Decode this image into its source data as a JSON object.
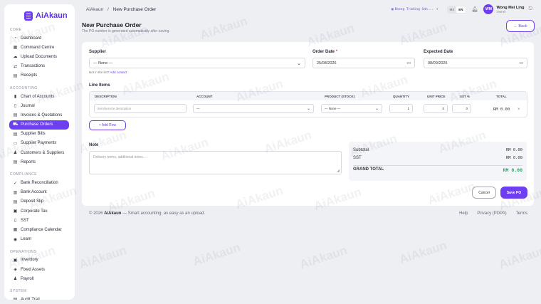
{
  "brand": {
    "name": "AiAkaun"
  },
  "sidebar": {
    "sections": [
      {
        "label": "CORE",
        "items": [
          {
            "label": "Dashboard",
            "icon": "gauge-icon"
          },
          {
            "label": "Command Centre",
            "icon": "grid-icon"
          },
          {
            "label": "Upload Documents",
            "icon": "cloud-upload-icon"
          },
          {
            "label": "Transactions",
            "icon": "transfer-icon"
          },
          {
            "label": "Receipts",
            "icon": "receipt-icon"
          }
        ]
      },
      {
        "label": "ACCOUNTING",
        "items": [
          {
            "label": "Chart of Accounts",
            "icon": "bar-chart-icon"
          },
          {
            "label": "Journal",
            "icon": "book-icon"
          },
          {
            "label": "Invoices & Quotations",
            "icon": "invoice-icon"
          },
          {
            "label": "Purchase Orders",
            "icon": "cart-icon"
          },
          {
            "label": "Supplier Bills",
            "icon": "bill-icon"
          },
          {
            "label": "Supplier Payments",
            "icon": "card-icon"
          },
          {
            "label": "Customers & Suppliers",
            "icon": "users-icon"
          },
          {
            "label": "Reports",
            "icon": "report-icon"
          }
        ]
      },
      {
        "label": "COMPLIANCE",
        "items": [
          {
            "label": "Bank Reconciliation",
            "icon": "check-icon"
          },
          {
            "label": "Bank Account",
            "icon": "bank-icon"
          },
          {
            "label": "Deposit Slip",
            "icon": "slip-icon"
          },
          {
            "label": "Corporate Tax",
            "icon": "tax-icon"
          },
          {
            "label": "SST",
            "icon": "document-icon"
          },
          {
            "label": "Compliance Calendar",
            "icon": "calendar-icon"
          },
          {
            "label": "Learn",
            "icon": "learn-icon"
          }
        ]
      },
      {
        "label": "OPERATIONS",
        "items": [
          {
            "label": "Inventory",
            "icon": "box-icon"
          },
          {
            "label": "Fixed Assets",
            "icon": "asset-icon"
          },
          {
            "label": "Payroll",
            "icon": "payroll-icon"
          }
        ]
      },
      {
        "label": "SYSTEM",
        "items": [
          {
            "label": "Audit Trail",
            "icon": "audit-icon"
          }
        ]
      }
    ],
    "active": "Purchase Orders"
  },
  "breadcrumb": {
    "root": "AiAkaun",
    "separator": "/",
    "current": "New Purchase Order"
  },
  "topbar": {
    "company": "Boong Trading Sdn...",
    "lang_ms": "MS",
    "lang_en": "EN",
    "user_initials": "WM",
    "user_name": "Wong Mei Ling",
    "user_role": "Owner"
  },
  "page": {
    "title": "New Purchase Order",
    "subtitle": "The PO number is generated automatically after saving.",
    "back_label": "← Back"
  },
  "form": {
    "supplier_label": "Supplier",
    "supplier_value": "— None —",
    "not_listed": "Not in the list?",
    "add_contact": "Add contact",
    "order_date_label": "Order Date",
    "order_date_required": "*",
    "order_date_value": "25/08/2026",
    "expected_date_label": "Expected Date",
    "expected_date_value": "08/09/2026",
    "line_items_label": "Line Items",
    "columns": [
      "DESCRIPTION",
      "ACCOUNT",
      "PRODUCT (STOCK)",
      "QUANTITY",
      "UNIT PRICE",
      "SST %",
      "TOTAL"
    ],
    "row": {
      "description_placeholder": "Item/service description",
      "account_value": "—",
      "product_value": "— None —",
      "quantity": "1",
      "unit_price": "0",
      "sst": "0",
      "total": "RM 0.00",
      "remove": "×"
    },
    "add_row_label": "+ Add Row",
    "note_label": "Note",
    "note_placeholder": "Delivery terms, additional notes..."
  },
  "totals": {
    "subtotal_label": "Subtotal",
    "subtotal_value": "RM 0.00",
    "sst_label": "SST",
    "sst_value": "RM 0.00",
    "grand_label": "GRAND TOTAL",
    "grand_value": "RM 0.00"
  },
  "actions": {
    "cancel_label": "Cancel",
    "save_label": "Save PO"
  },
  "footer": {
    "copyright": "© 2026",
    "brand": "AiAkaun",
    "tagline": "— Smart accounting, as easy as an upload.",
    "links": [
      "Help",
      "Privacy (PDPA)",
      "Terms"
    ]
  },
  "watermark": "AiAkaun",
  "colors": {
    "accent": "#6d3ff0",
    "grand_total": "#24a86b",
    "background": "#eeeff3"
  }
}
